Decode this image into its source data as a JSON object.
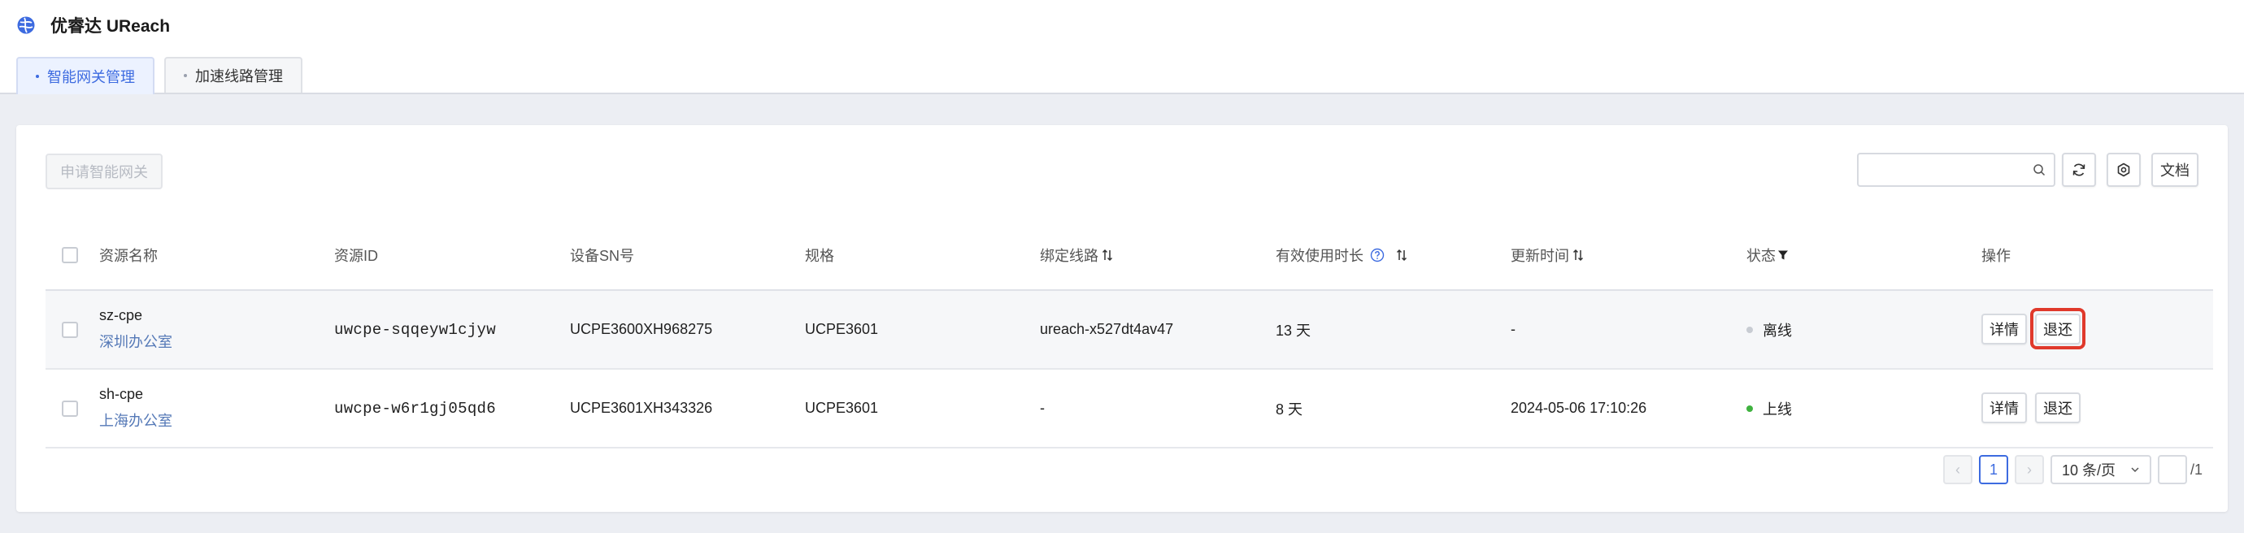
{
  "app": {
    "title": "优睿达 UReach",
    "logo_icon": "globe-logo-icon",
    "accent_color": "#3d6be0"
  },
  "tabs": [
    {
      "label": "智能网关管理",
      "active": true
    },
    {
      "label": "加速线路管理",
      "active": false
    }
  ],
  "toolbar": {
    "apply_label": "申请智能网关",
    "search_placeholder": "",
    "search_value": "",
    "refresh_icon": "refresh-icon",
    "settings_icon": "settings-icon",
    "docs_label": "文档"
  },
  "table": {
    "columns": [
      {
        "label": "资源名称"
      },
      {
        "label": "资源ID"
      },
      {
        "label": "设备SN号"
      },
      {
        "label": "规格"
      },
      {
        "label": "绑定线路",
        "sortable": true
      },
      {
        "label": "有效使用时长",
        "sortable": true,
        "help": true
      },
      {
        "label": "更新时间",
        "sortable": true
      },
      {
        "label": "状态",
        "filterable": true
      },
      {
        "label": "操作"
      }
    ],
    "rows": [
      {
        "name": "sz-cpe",
        "location": "深圳办公室",
        "id": "uwcpe-sqqeyw1cjyw",
        "sn": "UCPE3600XH968275",
        "spec": "UCPE3601",
        "line": "ureach-x527dt4av47",
        "duration": "13 天",
        "updated": "-",
        "status": "离线",
        "status_color": "#c8ccd3",
        "detail_label": "详情",
        "return_label": "退还"
      },
      {
        "name": "sh-cpe",
        "location": "上海办公室",
        "id": "uwcpe-w6r1gj05qd6",
        "sn": "UCPE3601XH343326",
        "spec": "UCPE3601",
        "line": "-",
        "duration": "8 天",
        "updated": "2024-05-06 17:10:26",
        "status": "上线",
        "status_color": "#3fb23f",
        "detail_label": "详情",
        "return_label": "退还"
      }
    ]
  },
  "pagination": {
    "prev_label": "‹",
    "current_page": "1",
    "next_label": "›",
    "page_size_label": "10 条/页",
    "jump_value": "",
    "total_pages_label": "/1"
  }
}
